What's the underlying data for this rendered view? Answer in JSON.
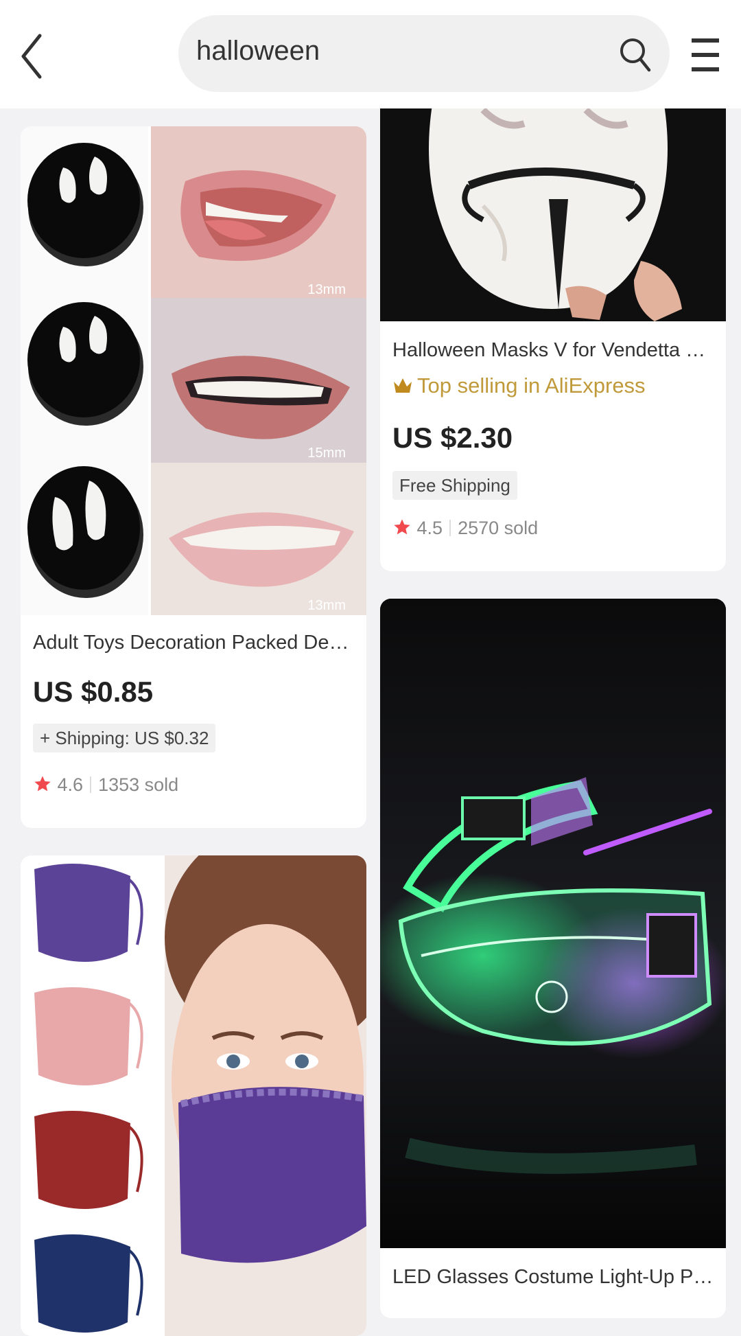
{
  "search": {
    "query": "halloween"
  },
  "icons": {
    "back": "chevron-left-icon",
    "search": "search-icon",
    "menu": "menu-icon",
    "star": "star-icon",
    "crown": "crown-icon"
  },
  "colors": {
    "accent_star": "#f04a4f",
    "top_selling": "#c09a3a"
  },
  "products": {
    "teeth": {
      "title": "Adult Toys Decoration Packed Denture…",
      "price": "US $0.85",
      "shipping": "+ Shipping: US $0.32",
      "rating": "4.6",
      "sold": "1353 sold",
      "image_labels": [
        "13mm",
        "15mm",
        "13mm"
      ]
    },
    "vendetta": {
      "title": "Halloween Masks V for Vendetta Mask …",
      "tag": "Top selling in AliExpress",
      "price": "US $2.30",
      "shipping": "Free Shipping",
      "rating": "4.5",
      "sold": "2570 sold"
    },
    "led": {
      "title": "LED Glasses Costume Light-Up Party D…"
    }
  }
}
